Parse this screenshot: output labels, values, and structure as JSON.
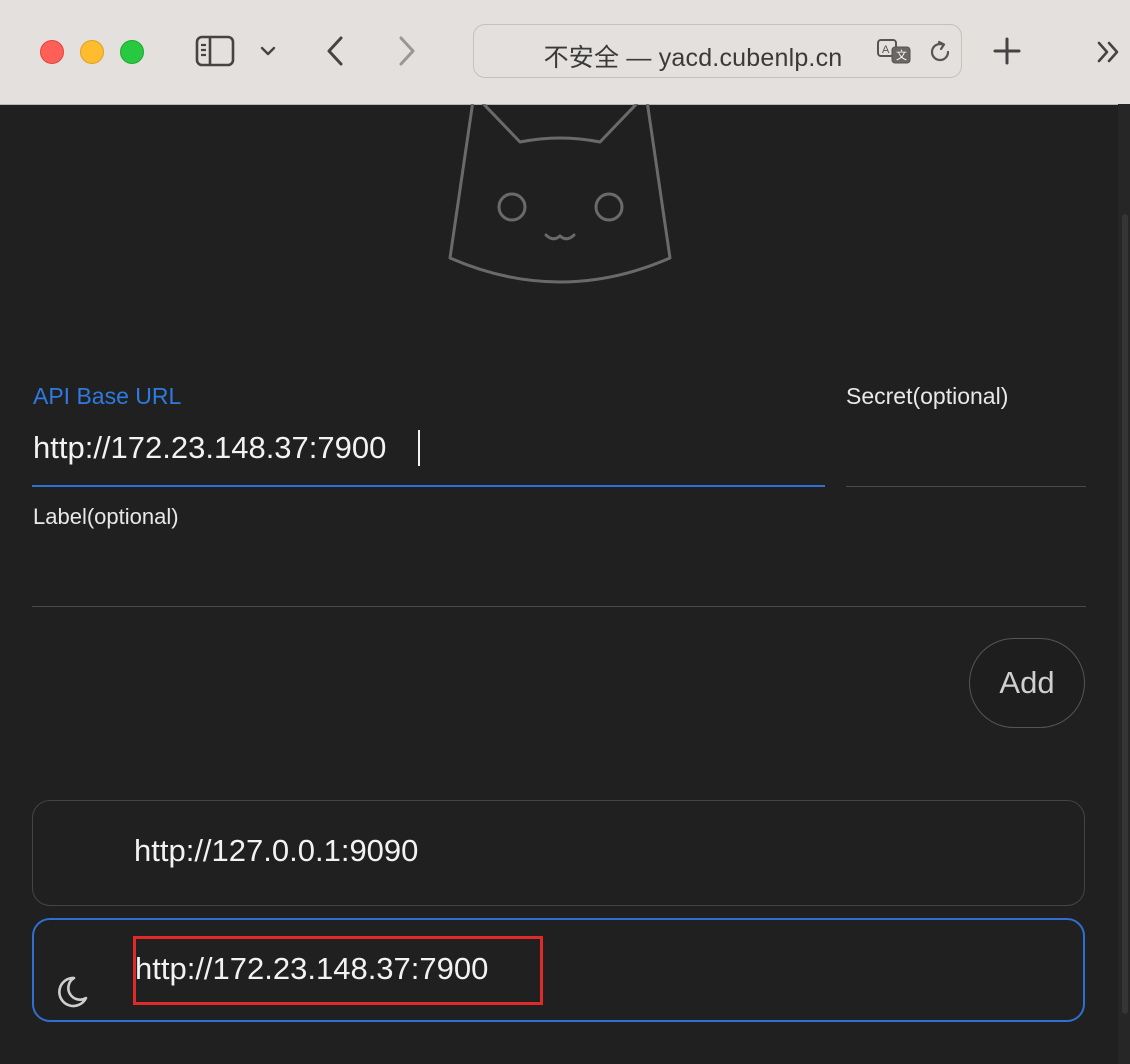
{
  "browser": {
    "address_text": "不安全 — yacd.cubenlp.cn",
    "icons": [
      "sidebar-icon",
      "chevron-down-icon",
      "back-icon",
      "forward-icon",
      "translate-icon",
      "reload-icon",
      "new-tab-icon",
      "more-tabs-icon"
    ]
  },
  "form": {
    "api_label": "API Base URL",
    "api_value": "http://172.23.148.37:7900",
    "secret_label": "Secret(optional)",
    "secret_value": "",
    "label_label": "Label(optional)",
    "label_value": "",
    "add_button": "Add"
  },
  "backends": [
    {
      "url": "http://127.0.0.1:9090",
      "selected": false
    },
    {
      "url": "http://172.23.148.37:7900",
      "selected": true
    }
  ],
  "theme_icon": "moon-icon",
  "colors": {
    "background": "#202020",
    "accent": "#2f7ae0",
    "highlight_box": "#e02a2a"
  }
}
